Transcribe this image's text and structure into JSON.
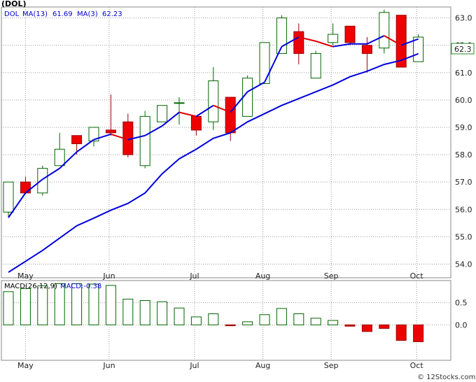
{
  "chart_data": [
    {
      "type": "candlestick",
      "title": "(DOL)",
      "legend": {
        "symbol": "DOL",
        "ma13_label": "MA(13)",
        "ma13_value": "61.69",
        "ma3_label": "MA(3)",
        "ma3_value": "62.23"
      },
      "last_price_label": "62.3",
      "ylim": [
        53.5,
        63.4
      ],
      "yticks": [
        "54.0",
        "55.0",
        "56.0",
        "57.0",
        "58.0",
        "59.0",
        "60.0",
        "61.0",
        "62.0",
        "63.0"
      ],
      "xticks": [
        "May",
        "Jun",
        "Jul",
        "Aug",
        "Sep",
        "Oct"
      ],
      "xtick_weeks": [
        1,
        5.9,
        10.9,
        14.9,
        18.9,
        23.9
      ],
      "candles": [
        {
          "o": 55.9,
          "h": 57.0,
          "l": 55.7,
          "c": 57.0
        },
        {
          "o": 57.0,
          "h": 57.2,
          "l": 56.6,
          "c": 56.6
        },
        {
          "o": 56.6,
          "h": 57.6,
          "l": 56.5,
          "c": 57.5
        },
        {
          "o": 57.6,
          "h": 58.8,
          "l": 57.6,
          "c": 58.2
        },
        {
          "o": 58.7,
          "h": 58.7,
          "l": 58.0,
          "c": 58.4
        },
        {
          "o": 58.5,
          "h": 59.0,
          "l": 58.3,
          "c": 59.0
        },
        {
          "o": 58.9,
          "h": 60.2,
          "l": 58.7,
          "c": 58.8
        },
        {
          "o": 59.2,
          "h": 59.5,
          "l": 57.9,
          "c": 58.0
        },
        {
          "o": 57.6,
          "h": 59.6,
          "l": 57.5,
          "c": 59.4
        },
        {
          "o": 59.2,
          "h": 59.8,
          "l": 59.2,
          "c": 59.8
        },
        {
          "o": 59.9,
          "h": 60.1,
          "l": 59.1,
          "c": 59.9
        },
        {
          "o": 59.4,
          "h": 59.4,
          "l": 58.7,
          "c": 58.9
        },
        {
          "o": 59.2,
          "h": 61.2,
          "l": 58.9,
          "c": 60.7
        },
        {
          "o": 60.1,
          "h": 60.1,
          "l": 58.5,
          "c": 58.8
        },
        {
          "o": 59.4,
          "h": 60.9,
          "l": 59.4,
          "c": 60.8
        },
        {
          "o": 60.6,
          "h": 62.1,
          "l": 60.6,
          "c": 62.1
        },
        {
          "o": 61.7,
          "h": 63.1,
          "l": 61.7,
          "c": 63.0
        },
        {
          "o": 62.5,
          "h": 62.8,
          "l": 61.3,
          "c": 61.7
        },
        {
          "o": 60.8,
          "h": 61.8,
          "l": 60.8,
          "c": 61.7
        },
        {
          "o": 62.1,
          "h": 62.8,
          "l": 62.0,
          "c": 62.4
        },
        {
          "o": 62.7,
          "h": 62.7,
          "l": 62.0,
          "c": 62.1
        },
        {
          "o": 62.0,
          "h": 62.3,
          "l": 61.0,
          "c": 61.7
        },
        {
          "o": 61.9,
          "h": 63.3,
          "l": 61.7,
          "c": 63.2
        },
        {
          "o": 63.1,
          "h": 63.1,
          "l": 61.2,
          "c": 61.2
        },
        {
          "o": 61.4,
          "h": 62.4,
          "l": 61.4,
          "c": 62.3
        }
      ],
      "series": [
        {
          "name": "MA(13)",
          "color": "#0000dd",
          "values": [
            53.7,
            54.1,
            54.5,
            54.95,
            55.4,
            55.68,
            55.97,
            56.22,
            56.6,
            57.3,
            57.85,
            58.2,
            58.6,
            58.8,
            59.2,
            59.5,
            59.8,
            60.05,
            60.3,
            60.55,
            60.85,
            61.05,
            61.3,
            61.45,
            61.69
          ]
        },
        {
          "name": "MA(3)",
          "color_up": "#0000dd",
          "color_down": "#dd0000",
          "values": [
            55.7,
            56.6,
            57.1,
            57.5,
            58.1,
            58.55,
            58.75,
            58.55,
            58.7,
            59.05,
            59.55,
            59.4,
            59.8,
            59.55,
            60.3,
            60.65,
            61.95,
            62.3,
            62.15,
            61.95,
            62.05,
            62.05,
            62.35,
            62.0,
            62.23
          ]
        }
      ],
      "colors": {
        "up_fill": "#ffffff",
        "up_stroke": "#006600",
        "down_fill": "#ee0000",
        "down_stroke": "#990000",
        "grid": "#999999"
      }
    },
    {
      "type": "bar",
      "title": "MACD(26,12,9)",
      "legend": {
        "label": "MACD(26,12,9)",
        "value_text": "MACD:-0.38"
      },
      "ylim": [
        -0.8,
        1.0
      ],
      "yticks": [
        "0.5",
        "0.0"
      ],
      "ytick_values": [
        0.5,
        0.0
      ],
      "xticks": [
        "May",
        "Jun",
        "Jul",
        "Aug",
        "Sep",
        "Oct"
      ],
      "values": [
        0.75,
        0.82,
        0.88,
        0.93,
        0.93,
        0.92,
        0.89,
        0.58,
        0.55,
        0.52,
        0.38,
        0.18,
        0.25,
        -0.02,
        0.07,
        0.23,
        0.37,
        0.25,
        0.15,
        0.1,
        -0.03,
        -0.15,
        -0.08,
        -0.35,
        -0.38
      ],
      "colors": {
        "pos_stroke": "#006600",
        "neg_fill": "#ee0000",
        "neg_stroke": "#990000"
      }
    }
  ],
  "watermark": "© 12Stocks.com"
}
